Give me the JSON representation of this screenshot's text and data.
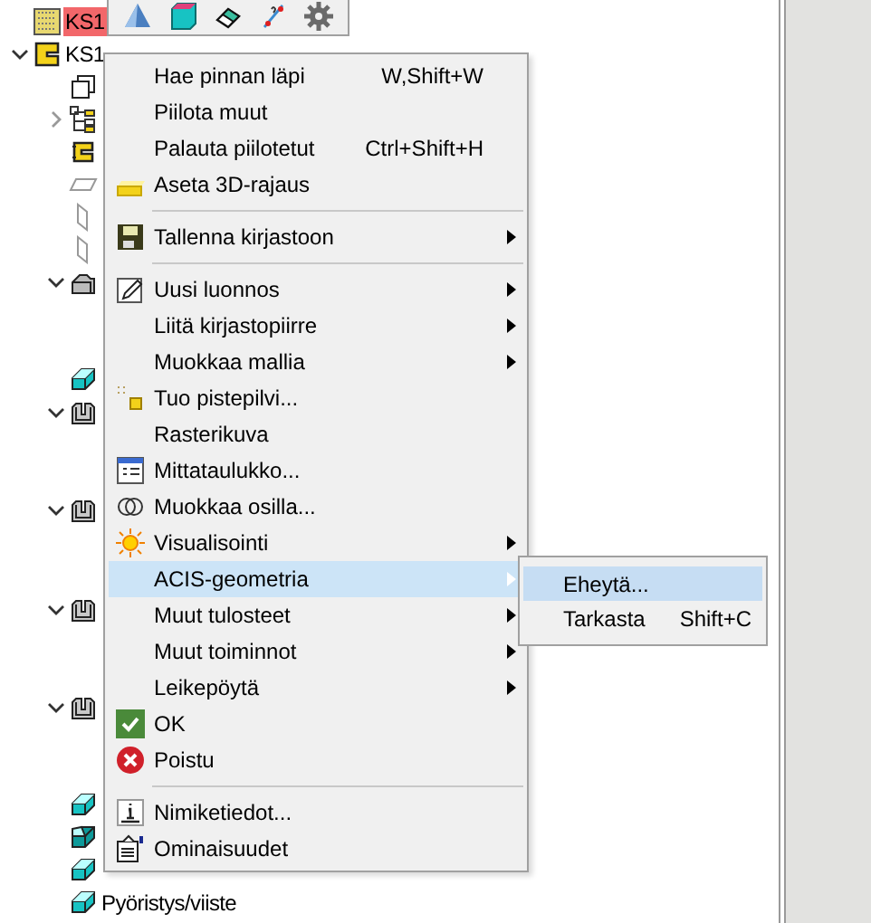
{
  "toolbar": {
    "tools": [
      {
        "kind": "pyramid"
      },
      {
        "kind": "box"
      },
      {
        "kind": "eraser"
      },
      {
        "kind": "dimension"
      },
      {
        "kind": "gear"
      }
    ]
  },
  "tree": [
    {
      "label": "KS1",
      "kind": "dotted",
      "selected": true
    },
    {
      "label": "KS1",
      "kind": "c-part",
      "selected": false,
      "expanded": true,
      "children": [
        {
          "kind": "pages"
        },
        {
          "kind": "tree",
          "expanded": false
        },
        {
          "kind": "magnet"
        },
        {
          "kind": "plane-flat"
        },
        {
          "kind": "plane-side"
        },
        {
          "kind": "plane-side"
        },
        {
          "kind": "block",
          "expanded": true
        },
        {
          "kind": "cube"
        },
        {
          "kind": "u-part",
          "expanded": true
        },
        {
          "kind": "u-part",
          "expanded": true
        },
        {
          "kind": "u-part",
          "expanded": true
        },
        {
          "kind": "u-part",
          "expanded": true
        },
        {
          "kind": "cube"
        },
        {
          "kind": "cube-dark"
        },
        {
          "kind": "cube"
        },
        {
          "kind": "cube",
          "label": "Pyöristys/viiste"
        }
      ]
    }
  ],
  "context_menu": {
    "items": [
      {
        "kind": "plain",
        "label": "Hae pinnan läpi",
        "shortcut": "W,Shift+W"
      },
      {
        "kind": "plain",
        "label": "Piilota muut"
      },
      {
        "kind": "plain",
        "label": "Palauta piilotetut",
        "shortcut": "Ctrl+Shift+H"
      },
      {
        "kind": "bounds",
        "label": "Aseta 3D-rajaus"
      },
      {
        "kind": "separator"
      },
      {
        "kind": "save",
        "label": "Tallenna kirjastoon",
        "submenu": true
      },
      {
        "kind": "separator"
      },
      {
        "kind": "pencil",
        "label": "Uusi luonnos",
        "submenu": true
      },
      {
        "kind": "plain",
        "label": "Liitä kirjastopiirre",
        "submenu": true
      },
      {
        "kind": "plain",
        "label": "Muokkaa mallia",
        "submenu": true
      },
      {
        "kind": "points",
        "label": "Tuo pistepilvi..."
      },
      {
        "kind": "plain",
        "label": "Rasterikuva"
      },
      {
        "kind": "table",
        "label": "Mittataulukko..."
      },
      {
        "kind": "rings",
        "label": "Muokkaa osilla..."
      },
      {
        "kind": "sun",
        "label": "Visualisointi",
        "submenu": true
      },
      {
        "kind": "plain",
        "label": "ACIS-geometria",
        "submenu": true,
        "selected": true
      },
      {
        "kind": "plain",
        "label": "Muut tulosteet",
        "submenu": true
      },
      {
        "kind": "plain",
        "label": "Muut toiminnot",
        "submenu": true
      },
      {
        "kind": "plain",
        "label": "Leikepöytä",
        "submenu": true
      },
      {
        "kind": "ok",
        "label": "OK"
      },
      {
        "kind": "cancel",
        "label": "Poistu"
      },
      {
        "kind": "separator"
      },
      {
        "kind": "info",
        "label": "Nimiketiedot..."
      },
      {
        "kind": "properties",
        "label": "Ominaisuudet"
      }
    ]
  },
  "submenu": {
    "items": [
      {
        "label": "Eheytä...",
        "selected": true
      },
      {
        "label": "Tarkasta",
        "shortcut": "Shift+C",
        "selected": false
      }
    ]
  }
}
